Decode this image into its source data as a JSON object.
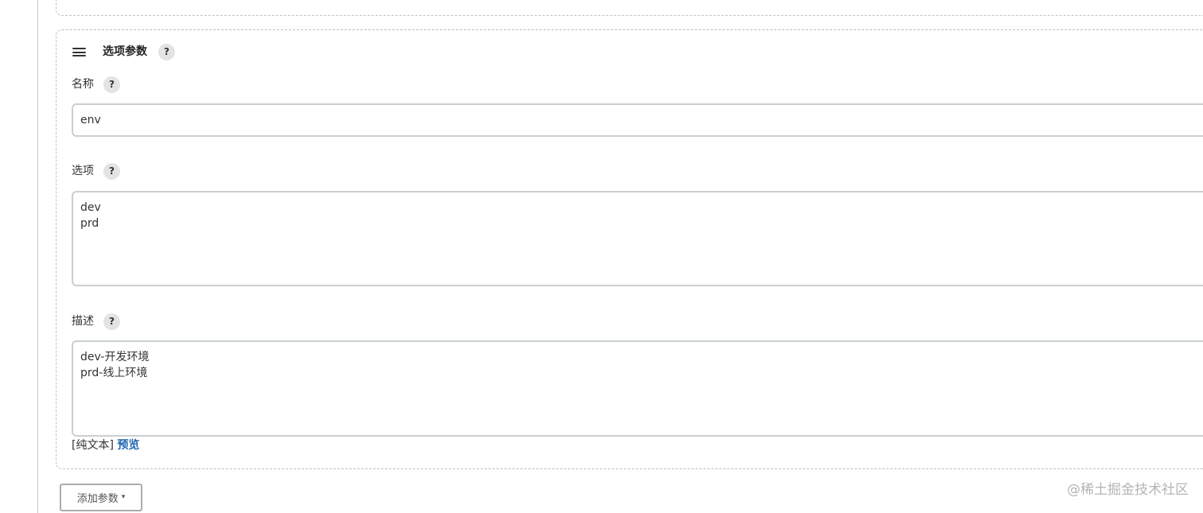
{
  "parameter": {
    "title": "选项参数",
    "help_label": "?",
    "name_field": {
      "label": "名称",
      "help_label": "?",
      "value": "env"
    },
    "choices_field": {
      "label": "选项",
      "help_label": "?",
      "lines": [
        "dev",
        "prd"
      ]
    },
    "description_field": {
      "label": "描述",
      "help_label": "?",
      "lines": [
        "dev-开发环境",
        "prd-线上环境"
      ]
    },
    "syntax": {
      "mode_label": "[纯文本]",
      "preview_label": "预览"
    }
  },
  "actions": {
    "add_parameter_label": "添加参数",
    "caret": "▾"
  },
  "watermark": "@稀土掘金技术社区",
  "colors": {
    "link": "#1f66b0",
    "dashed_border": "#c0c0c0",
    "input_border": "#c9cfd2"
  }
}
